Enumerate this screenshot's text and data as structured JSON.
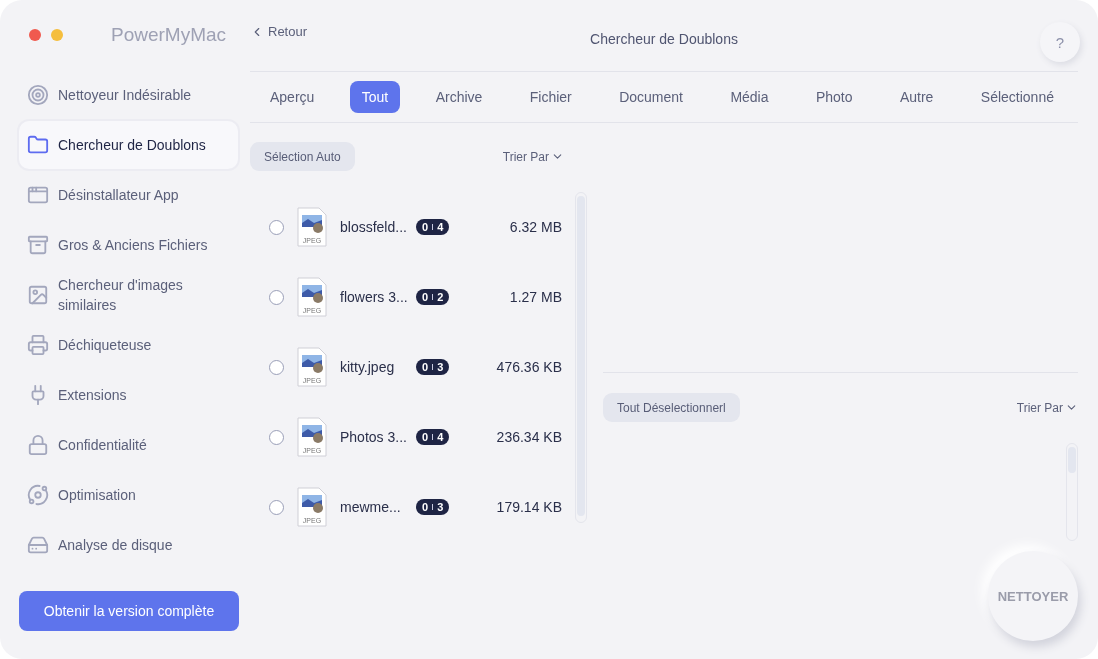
{
  "window": {
    "title": "PowerMyMac"
  },
  "sidebar": {
    "items": [
      {
        "label": "Nettoyeur Indésirable",
        "selected": false
      },
      {
        "label": "Chercheur de Doublons",
        "selected": true
      },
      {
        "label": "Désinstallateur App",
        "selected": false
      },
      {
        "label": "Gros & Anciens Fichiers",
        "selected": false
      },
      {
        "label": "Chercheur d'images similaires",
        "selected": false
      },
      {
        "label": "Déchiqueteuse",
        "selected": false
      },
      {
        "label": "Extensions",
        "selected": false
      },
      {
        "label": "Confidentialité",
        "selected": false
      },
      {
        "label": "Optimisation",
        "selected": false
      },
      {
        "label": "Analyse de disque",
        "selected": false
      }
    ],
    "upgrade_button": "Obtenir la version complète"
  },
  "header": {
    "back": "Retour",
    "title": "Chercheur de Doublons",
    "help": "?"
  },
  "tabs": [
    {
      "label": "Aperçu",
      "selected": false
    },
    {
      "label": "Tout",
      "selected": true
    },
    {
      "label": "Archive",
      "selected": false
    },
    {
      "label": "Fichier",
      "selected": false
    },
    {
      "label": "Document",
      "selected": false
    },
    {
      "label": "Média",
      "selected": false
    },
    {
      "label": "Photo",
      "selected": false
    },
    {
      "label": "Autre",
      "selected": false
    },
    {
      "label": "Sélectionné",
      "selected": false
    }
  ],
  "file_list": {
    "auto_select": "Sélection Auto",
    "sort": "Trier Par",
    "rows": [
      {
        "name": "blossfeld...",
        "type": "JPEG",
        "badge": [
          "0",
          "4"
        ],
        "size": "6.32 MB",
        "checked": false
      },
      {
        "name": "flowers 3...",
        "type": "JPEG",
        "badge": [
          "0",
          "2"
        ],
        "size": "1.27 MB",
        "checked": false
      },
      {
        "name": "kitty.jpeg",
        "type": "JPEG",
        "badge": [
          "0",
          "3"
        ],
        "size": "476.36 KB",
        "checked": false
      },
      {
        "name": "Photos 3...",
        "type": "JPEG",
        "badge": [
          "0",
          "4"
        ],
        "size": "236.34 KB",
        "checked": false
      },
      {
        "name": "mewme...",
        "type": "JPEG",
        "badge": [
          "0",
          "3"
        ],
        "size": "179.14 KB",
        "checked": false
      }
    ]
  },
  "detail": {
    "deselect_all": "Tout Déselectionnerl",
    "sort": "Trier Par"
  },
  "clean_button": "NETTOYER"
}
